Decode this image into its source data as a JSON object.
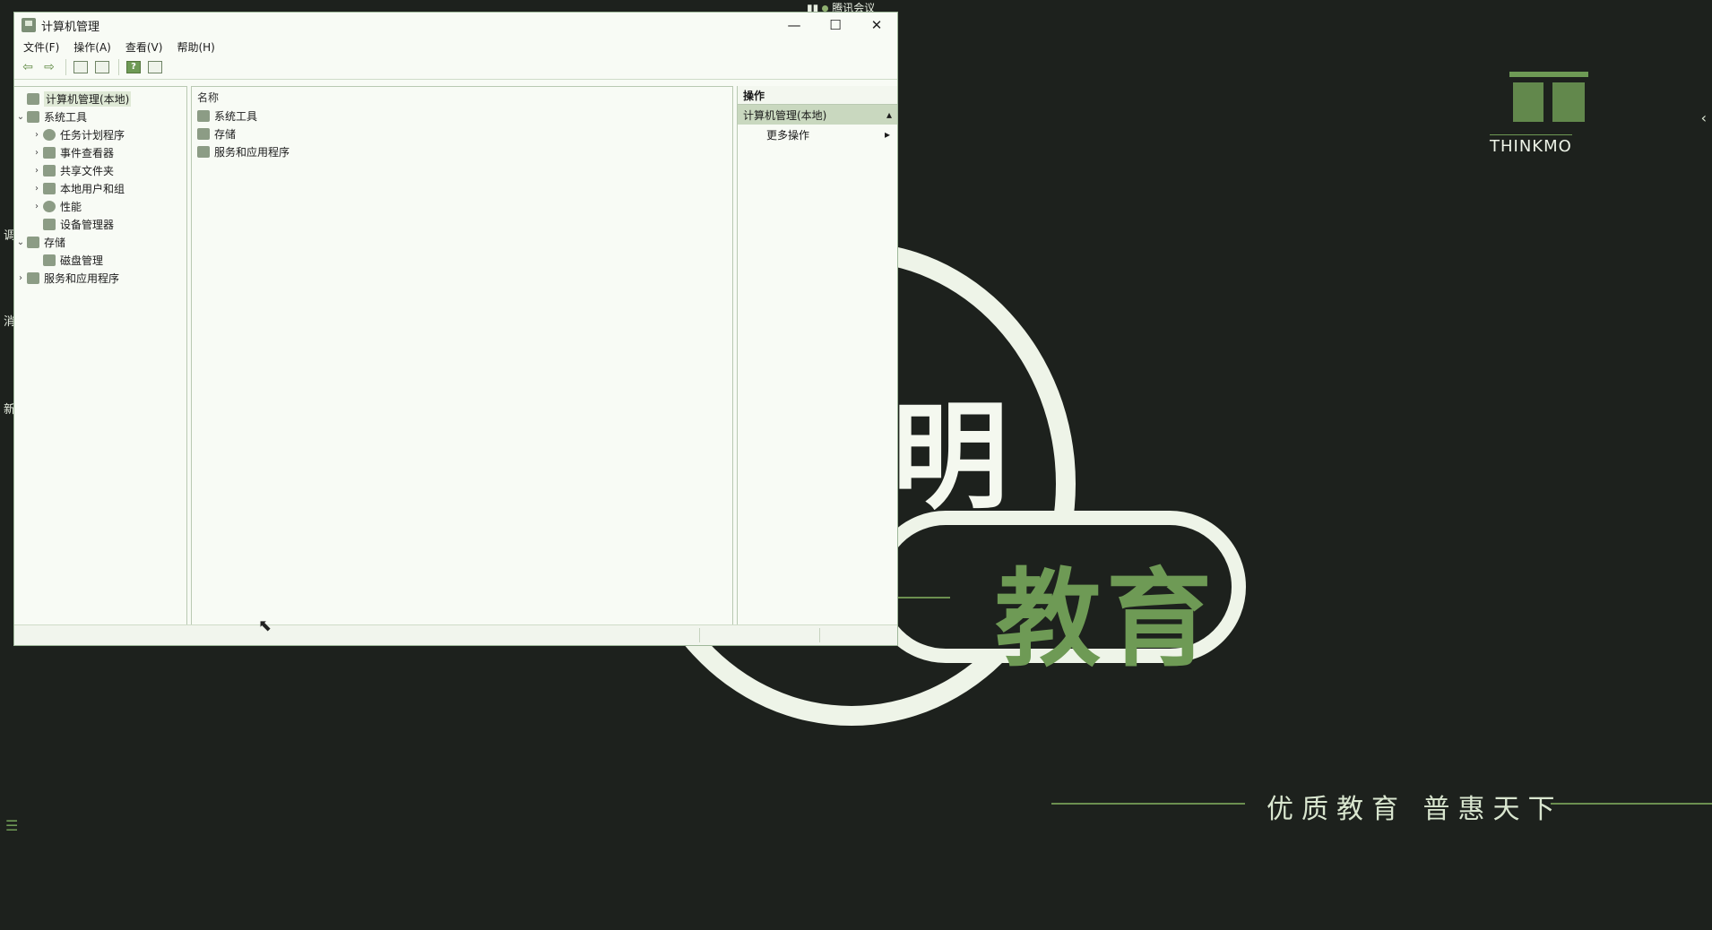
{
  "wallpaper": {
    "brand_text": "THINKMO",
    "pill_text": "教育",
    "big_char": "明",
    "slogan": "优质教育 普惠天下",
    "side_texts": [
      "调",
      "消",
      "新"
    ],
    "tray_text": "腾讯会议"
  },
  "window": {
    "title": "计算机管理",
    "controls": {
      "minimize": "—",
      "maximize": "☐",
      "close": "✕"
    },
    "menu": [
      "文件(F)",
      "操作(A)",
      "查看(V)",
      "帮助(H)"
    ],
    "tree": {
      "root": "计算机管理(本地)",
      "system_tools": "系统工具",
      "task_scheduler": "任务计划程序",
      "event_viewer": "事件查看器",
      "shared_folders": "共享文件夹",
      "local_users": "本地用户和组",
      "performance": "性能",
      "device_manager": "设备管理器",
      "storage": "存储",
      "disk_management": "磁盘管理",
      "services_apps": "服务和应用程序"
    },
    "center": {
      "column_name": "名称",
      "items": [
        "系统工具",
        "存储",
        "服务和应用程序"
      ]
    },
    "actions": {
      "header": "操作",
      "section": "计算机管理(本地)",
      "more": "更多操作"
    }
  }
}
